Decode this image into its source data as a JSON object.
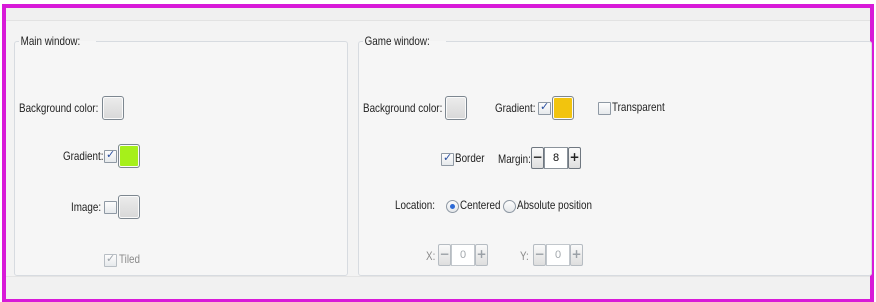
{
  "main_window": {
    "title": "Main window:",
    "background_color_label": "Background color:",
    "gradient_label": "Gradient:",
    "gradient_checked": true,
    "gradient_color": "#a6f01a",
    "image_label": "Image:",
    "image_checked": false,
    "tiled_label": "Tiled",
    "tiled_checked": true
  },
  "game_window": {
    "title": "Game window:",
    "background_color_label": "Background color:",
    "gradient_label": "Gradient:",
    "gradient_checked": true,
    "gradient_color": "#f2c40e",
    "transparent_label": "Transparent",
    "transparent_checked": false,
    "border_label": "Border",
    "border_checked": true,
    "margin_label": "Margin:",
    "margin_value": "8",
    "location_label": "Location:",
    "centered_label": "Centered",
    "absolute_label": "Absolute position",
    "location_selected": "Centered",
    "x_label": "X:",
    "x_value": "0",
    "y_label": "Y:",
    "y_value": "0",
    "minus_label": "−",
    "plus_label": "+"
  },
  "colors": {
    "frame_border": "#d81ad8",
    "default_swatch": "#dcdcdc"
  }
}
